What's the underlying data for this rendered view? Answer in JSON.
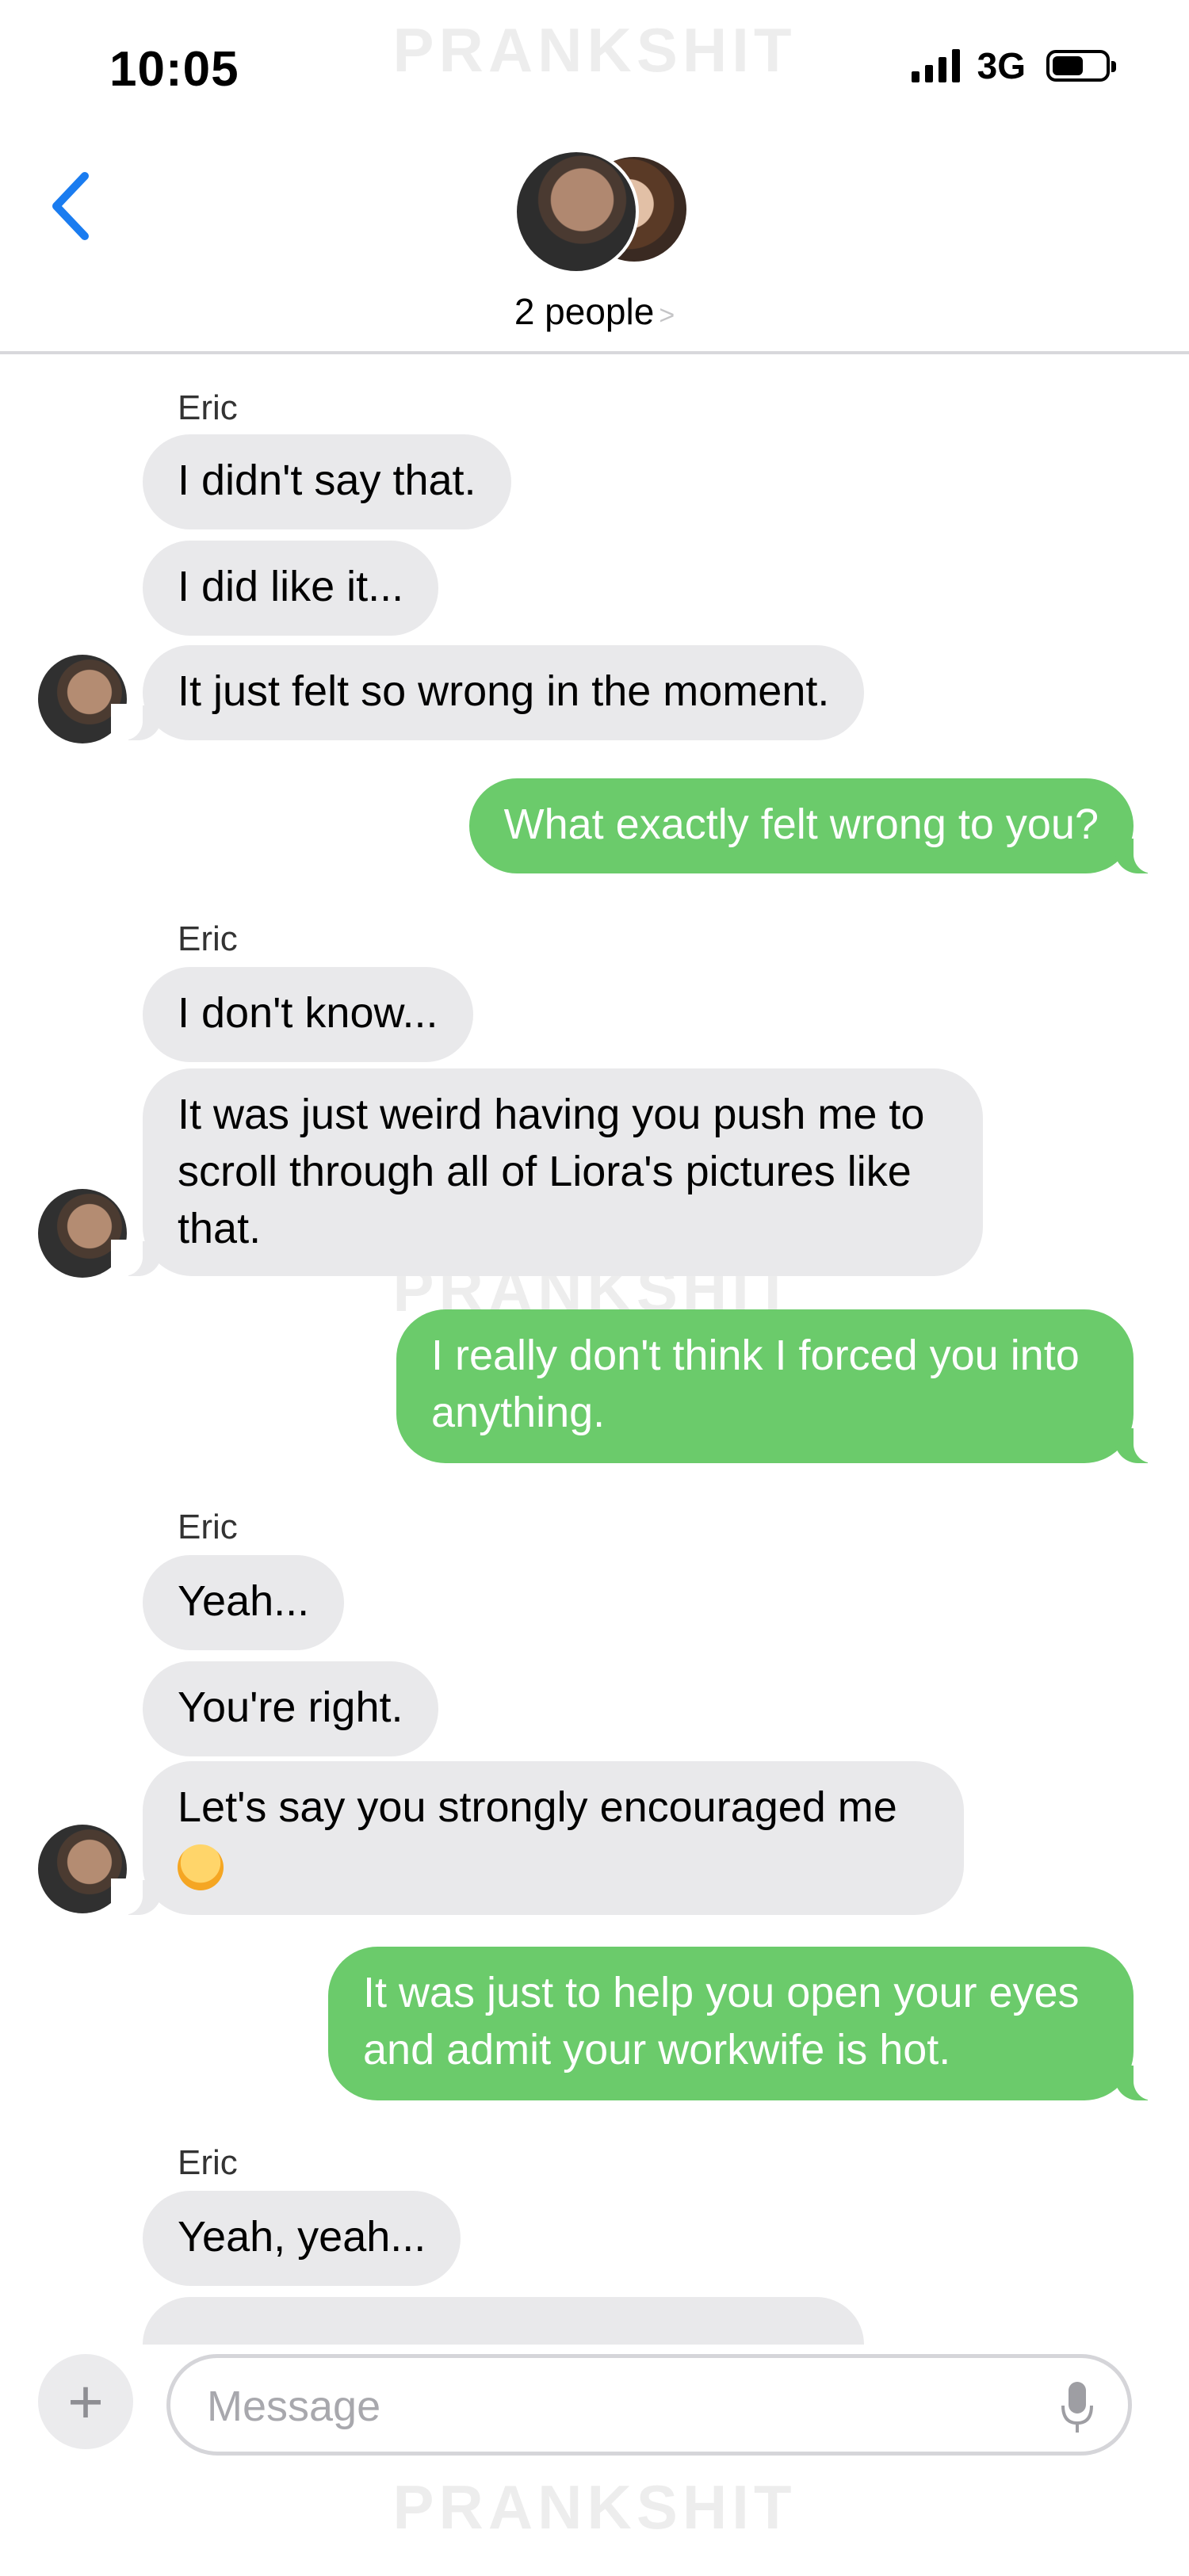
{
  "status_bar": {
    "time": "10:05",
    "network": "3G"
  },
  "watermark": "PRANKSHIT",
  "header": {
    "group_label": "2 people",
    "chevron": ">"
  },
  "messages": [
    {
      "sender": "Eric"
    },
    {
      "text": "I didn't say that."
    },
    {
      "text": "I did like it..."
    },
    {
      "text": "It just felt so wrong in the moment."
    },
    {
      "text": "What exactly felt wrong to you?"
    },
    {
      "sender": "Eric"
    },
    {
      "text": "I don't know..."
    },
    {
      "lines": [
        "It was just weird having you push me to",
        "scroll through all of Liora's pictures like",
        "that."
      ]
    },
    {
      "lines": [
        "I really don't think I forced you into",
        "anything."
      ]
    },
    {
      "sender": "Eric"
    },
    {
      "text": "Yeah..."
    },
    {
      "text": "You're right."
    },
    {
      "lines": [
        "Let's say you strongly encouraged me"
      ],
      "emoji": "grinning-sweat-face"
    },
    {
      "lines": [
        "It was just to help you open your eyes",
        "and admit your workwife is hot."
      ]
    },
    {
      "sender": "Eric"
    },
    {
      "text": "Yeah, yeah..."
    }
  ],
  "composer": {
    "placeholder": "Message"
  },
  "colors": {
    "incoming": "#e9e9eb",
    "outgoing": "#6bcb6b",
    "accent": "#1a7cf0"
  },
  "icons": [
    "back-chevron-icon",
    "signal-icon",
    "battery-icon",
    "plus-icon",
    "mic-icon"
  ]
}
